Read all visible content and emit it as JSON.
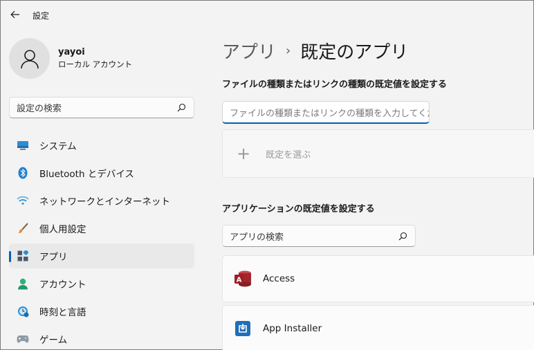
{
  "window": {
    "title": "設定"
  },
  "profile": {
    "name": "yayoi",
    "account_type": "ローカル アカウント"
  },
  "sidebar": {
    "search_placeholder": "設定の検索",
    "items": [
      {
        "label": "システム",
        "icon": "system-icon"
      },
      {
        "label": "Bluetooth とデバイス",
        "icon": "bluetooth-icon"
      },
      {
        "label": "ネットワークとインターネット",
        "icon": "wifi-icon"
      },
      {
        "label": "個人用設定",
        "icon": "brush-icon"
      },
      {
        "label": "アプリ",
        "icon": "apps-icon",
        "active": true
      },
      {
        "label": "アカウント",
        "icon": "account-icon"
      },
      {
        "label": "時刻と言語",
        "icon": "time-language-icon"
      },
      {
        "label": "ゲーム",
        "icon": "gaming-icon"
      }
    ]
  },
  "main": {
    "breadcrumb": {
      "parent": "アプリ",
      "separator": "›",
      "current": "既定のアプリ"
    },
    "filetype_section": {
      "title": "ファイルの種類またはリンクの種類の既定値を設定する",
      "input_placeholder": "ファイルの種類またはリンクの種類を入力してください",
      "choose_default_label": "既定を選ぶ"
    },
    "apps_section": {
      "title": "アプリケーションの既定値を設定する",
      "search_placeholder": "アプリの検索",
      "apps": [
        {
          "name": "Access",
          "icon": "access-app-icon"
        },
        {
          "name": "App Installer",
          "icon": "app-installer-icon"
        }
      ]
    }
  },
  "colors": {
    "accent": "#005fb8",
    "background": "#f3f3f3",
    "card": "#fbfbfb"
  }
}
